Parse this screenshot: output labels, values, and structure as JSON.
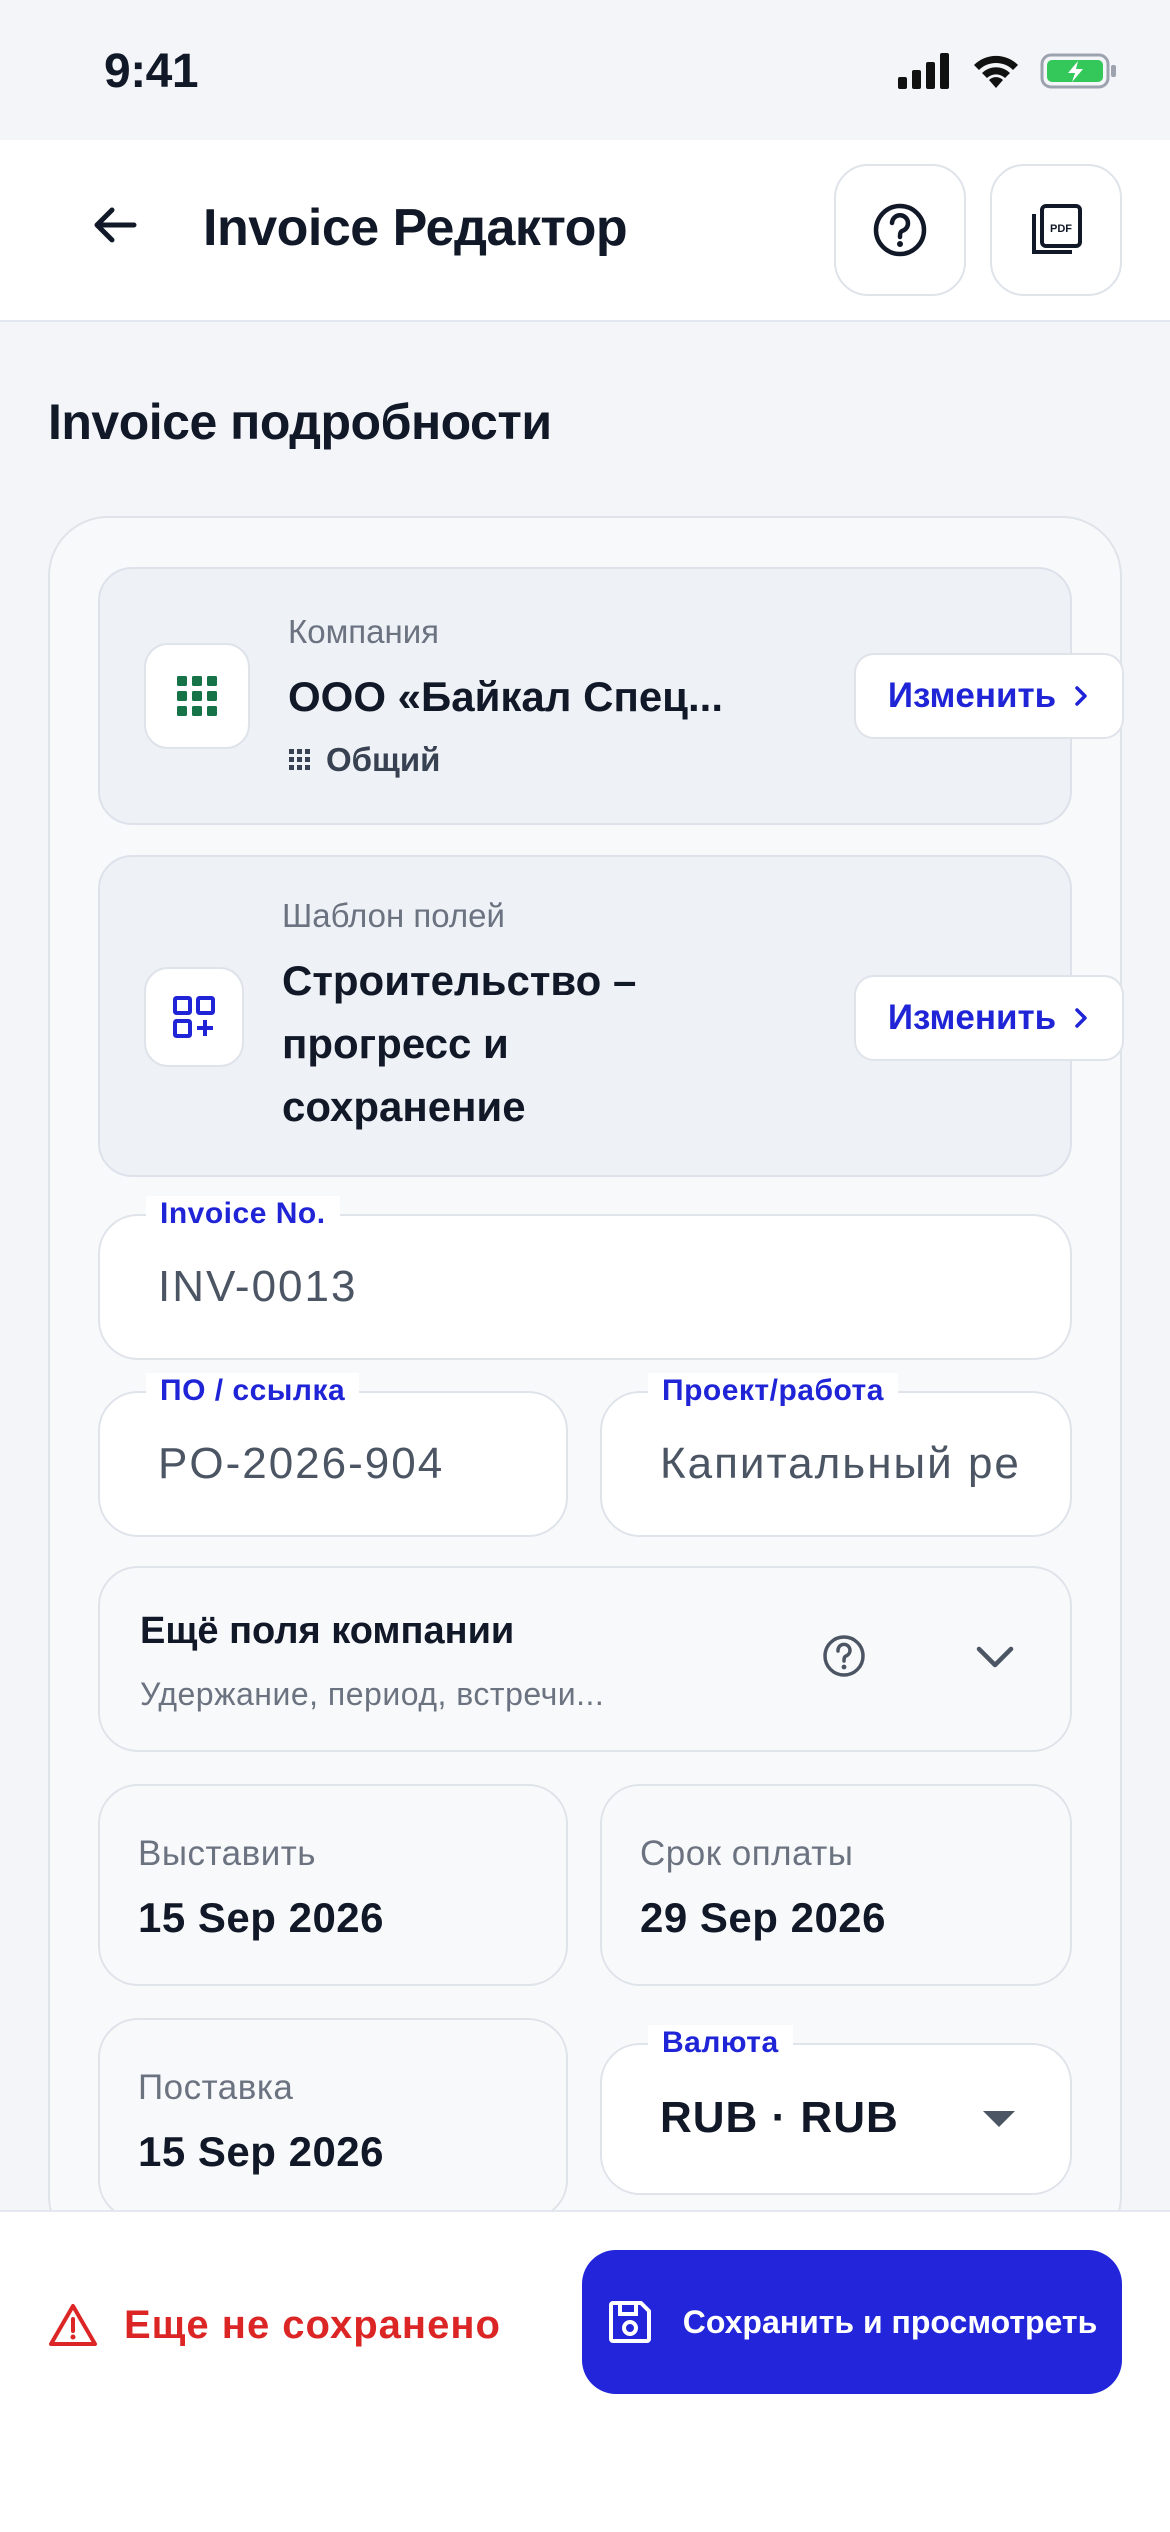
{
  "status_bar": {
    "time": "9:41"
  },
  "header": {
    "title": "Invoice Редактор"
  },
  "section": {
    "title": "Invoice подробности"
  },
  "company": {
    "label": "Компания",
    "name": "ООО «Байкал Спец...",
    "type": "Общий",
    "change_label": "Изменить"
  },
  "template": {
    "label": "Шаблон полей",
    "name": "Строительство –\nпрогресс и\nсохранение",
    "change_label": "Изменить"
  },
  "fields": {
    "invoice_no": {
      "label": "Invoice No.",
      "value": "INV-0013"
    },
    "po_ref": {
      "label": "ПО / ссылка",
      "value": "PO-2026-904"
    },
    "project": {
      "label": "Проект/работа",
      "value": "Капитальный ре"
    }
  },
  "more_fields": {
    "title": "Ещё поля компании",
    "subtitle": "Удержание, период, встречи..."
  },
  "dates": {
    "issue": {
      "label": "Выставить",
      "value": "15 Sep 2026"
    },
    "due": {
      "label": "Срок оплаты",
      "value": "29 Sep 2026"
    },
    "delivery": {
      "label": "Поставка",
      "value": "15 Sep 2026"
    }
  },
  "currency": {
    "label": "Валюта",
    "value": "RUB · RUB"
  },
  "footer": {
    "unsaved_text": "Еще не сохранено",
    "save_label": "Сохранить и просмотреть"
  },
  "colors": {
    "accent": "#2225d9",
    "danger": "#dc2626",
    "battery": "#34c759"
  }
}
